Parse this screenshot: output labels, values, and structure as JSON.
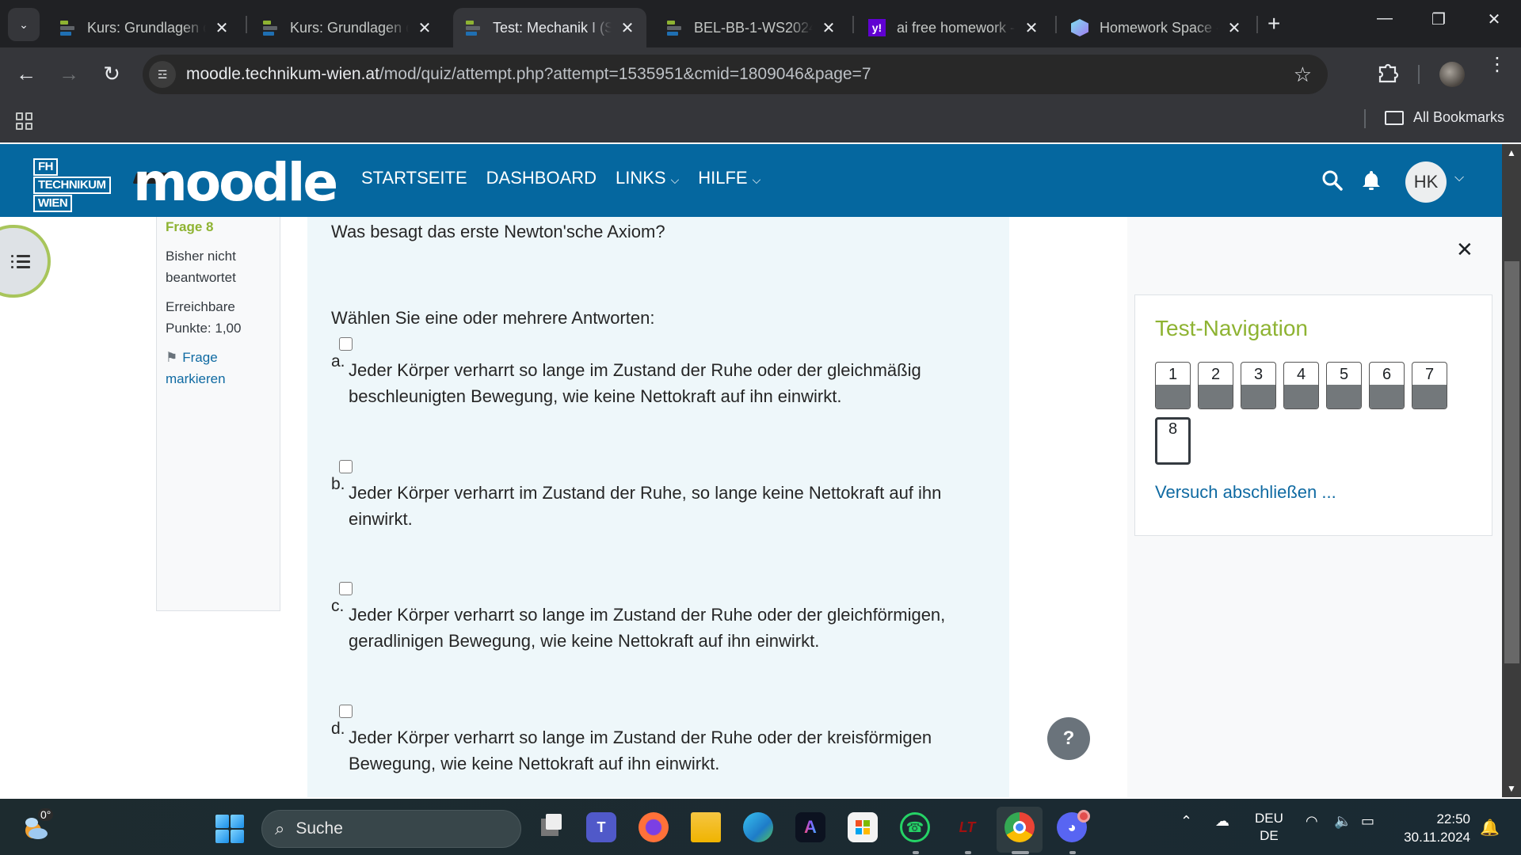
{
  "browser": {
    "tabs": [
      {
        "title": "Kurs: Grundlagen d",
        "icon": "moodle-icon",
        "active": false
      },
      {
        "title": "Kurs: Grundlagen d",
        "icon": "moodle-icon",
        "active": false
      },
      {
        "title": "Test: Mechanik I (S",
        "icon": "moodle-icon",
        "active": true
      },
      {
        "title": "BEL-BB-1-WS2024-",
        "icon": "moodle-icon",
        "active": false
      },
      {
        "title": "ai free homework -",
        "icon": "yahoo-icon",
        "active": false
      },
      {
        "title": "Homework Space -",
        "icon": "homework-space-icon",
        "active": false
      }
    ],
    "url_host": "moodle.technikum-wien.at",
    "url_path": "/mod/quiz/attempt.php?attempt=1535951&cmid=1809046&page=7",
    "bookmarks_label": "All Bookmarks"
  },
  "header": {
    "logo_lines": [
      "FH",
      "TECHNIKUM",
      "WIEN"
    ],
    "brand": "moodle",
    "nav": [
      {
        "label": "STARTSEITE",
        "dropdown": false
      },
      {
        "label": "DASHBOARD",
        "dropdown": false
      },
      {
        "label": "LINKS",
        "dropdown": true
      },
      {
        "label": "HILFE",
        "dropdown": true
      }
    ],
    "user_initials": "HK",
    "brand_color": "#05679f"
  },
  "question_info": {
    "question_label": "Frage 8",
    "status": "Bisher nicht beantwortet",
    "points": "Erreichbare Punkte: 1,00",
    "flag_label": "Frage markieren"
  },
  "question": {
    "text": "Was besagt das erste Newton'sche Axiom?",
    "prompt": "Wählen Sie eine oder mehrere Antworten:",
    "answers": [
      {
        "letter": "a.",
        "text": "Jeder Körper verharrt so lange im Zustand der Ruhe oder der gleichmäßig beschleunigten Bewegung, wie keine Nettokraft auf ihn einwirkt.",
        "checked": false
      },
      {
        "letter": "b.",
        "text": "Jeder Körper verharrt im Zustand der Ruhe, so lange keine Nettokraft auf ihn einwirkt.",
        "checked": false
      },
      {
        "letter": "c.",
        "text": "Jeder Körper verharrt so lange im Zustand der Ruhe oder der gleichförmigen, geradlinigen Bewegung, wie keine Nettokraft auf ihn einwirkt.",
        "checked": false
      },
      {
        "letter": "d.",
        "text": "Jeder Körper verharrt so lange im Zustand der Ruhe oder der kreisförmigen Bewegung, wie keine Nettokraft auf ihn einwirkt.",
        "checked": false
      }
    ]
  },
  "quiz_nav": {
    "title": "Test-Navigation",
    "questions": [
      {
        "num": "1",
        "answered": true,
        "current": false
      },
      {
        "num": "2",
        "answered": true,
        "current": false
      },
      {
        "num": "3",
        "answered": true,
        "current": false
      },
      {
        "num": "4",
        "answered": true,
        "current": false
      },
      {
        "num": "5",
        "answered": true,
        "current": false
      },
      {
        "num": "6",
        "answered": true,
        "current": false
      },
      {
        "num": "7",
        "answered": true,
        "current": false
      },
      {
        "num": "8",
        "answered": false,
        "current": true
      }
    ],
    "finish_label": "Versuch abschließen ..."
  },
  "help_label": "?",
  "taskbar": {
    "weather_temp": "0°",
    "search_placeholder": "Suche",
    "apps": [
      "task-view",
      "teams",
      "firefox",
      "file-explorer",
      "edge",
      "adobe-express",
      "microsoft-store",
      "whatsapp",
      "app-lt",
      "chrome",
      "discord"
    ],
    "lang_top": "DEU",
    "lang_bottom": "DE",
    "time": "22:50",
    "date": "30.11.2024"
  }
}
